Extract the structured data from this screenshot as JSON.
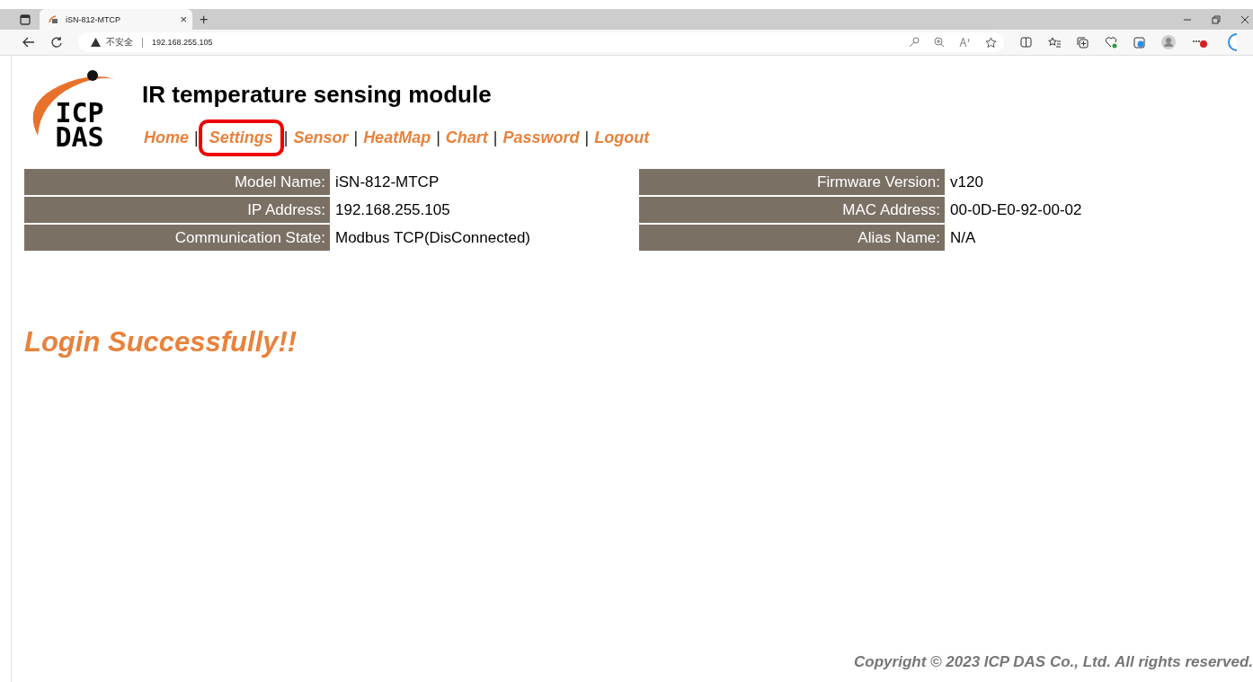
{
  "browser": {
    "tab_title": "iSN-812-MTCP",
    "tab_close": "×",
    "new_tab": "+",
    "security_label": "不安全",
    "address": "192.168.255.105"
  },
  "logo": {
    "line1": "ICP",
    "line2": "DAS"
  },
  "title": "IR temperature sensing module",
  "nav": [
    {
      "label": "Home",
      "highlighted": false,
      "separator": "|"
    },
    {
      "label": "Settings",
      "highlighted": true,
      "separator": "|"
    },
    {
      "label": "Sensor",
      "highlighted": false,
      "separator": "|"
    },
    {
      "label": "HeatMap",
      "highlighted": false,
      "separator": "|"
    },
    {
      "label": "Chart",
      "highlighted": false,
      "separator": "|"
    },
    {
      "label": "Password",
      "highlighted": false,
      "separator": "|"
    },
    {
      "label": "Logout",
      "highlighted": false
    }
  ],
  "info_left": [
    {
      "label": "Model Name:",
      "value": "iSN-812-MTCP"
    },
    {
      "label": "IP Address:",
      "value": "192.168.255.105"
    },
    {
      "label": "Communication State:",
      "value": "Modbus TCP(DisConnected)"
    }
  ],
  "info_right": [
    {
      "label": "Firmware Version:",
      "value": "v120"
    },
    {
      "label": "MAC Address:",
      "value": "00-0D-E0-92-00-02"
    },
    {
      "label": "Alias Name:",
      "value": "N/A"
    }
  ],
  "message": "Login Successfully!!",
  "footer": "Copyright © 2023 ICP DAS Co., Ltd. All rights reserved."
}
